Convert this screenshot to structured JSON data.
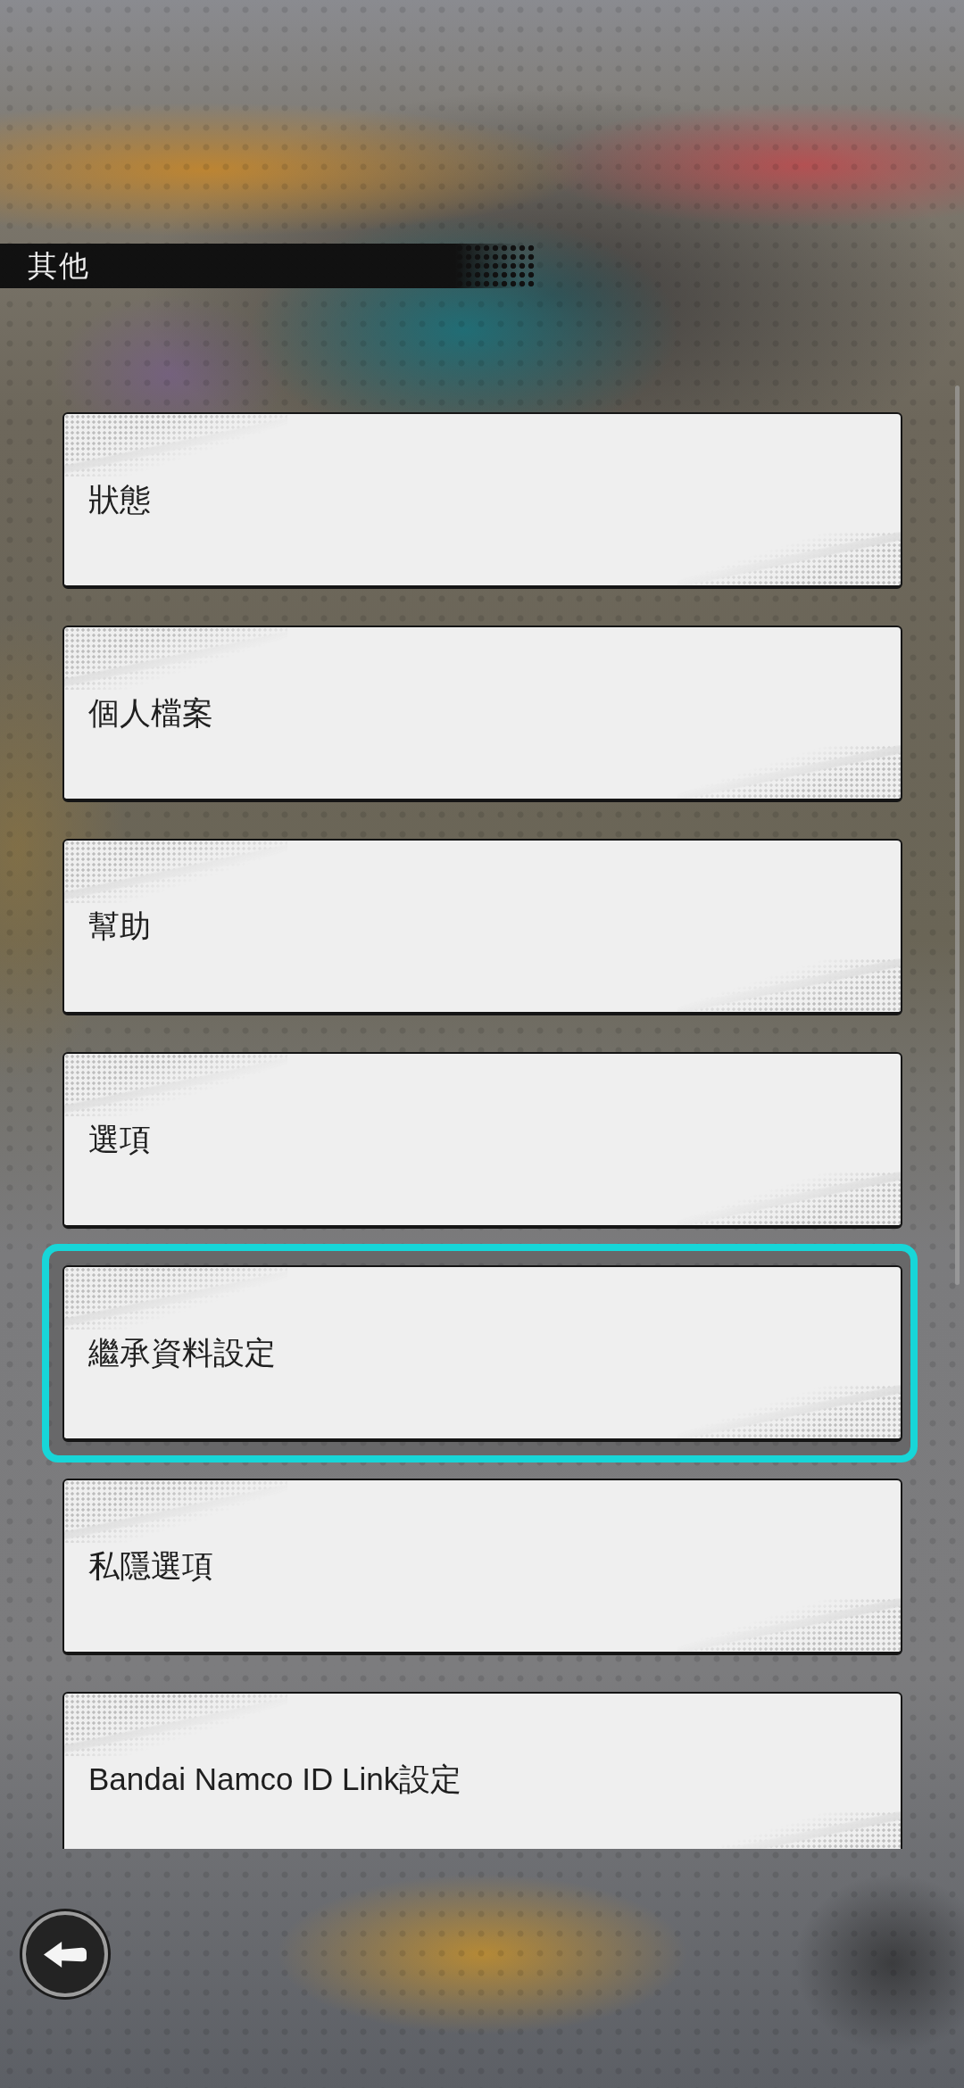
{
  "header": {
    "title": "其他"
  },
  "menu": {
    "items": [
      {
        "label": "狀態",
        "selected": false
      },
      {
        "label": "個人檔案",
        "selected": false
      },
      {
        "label": "幫助",
        "selected": false
      },
      {
        "label": "選項",
        "selected": false
      },
      {
        "label": "繼承資料設定",
        "selected": true
      },
      {
        "label": "私隱選項",
        "selected": false
      },
      {
        "label": "Bandai Namco ID Link設定",
        "selected": false
      }
    ]
  }
}
